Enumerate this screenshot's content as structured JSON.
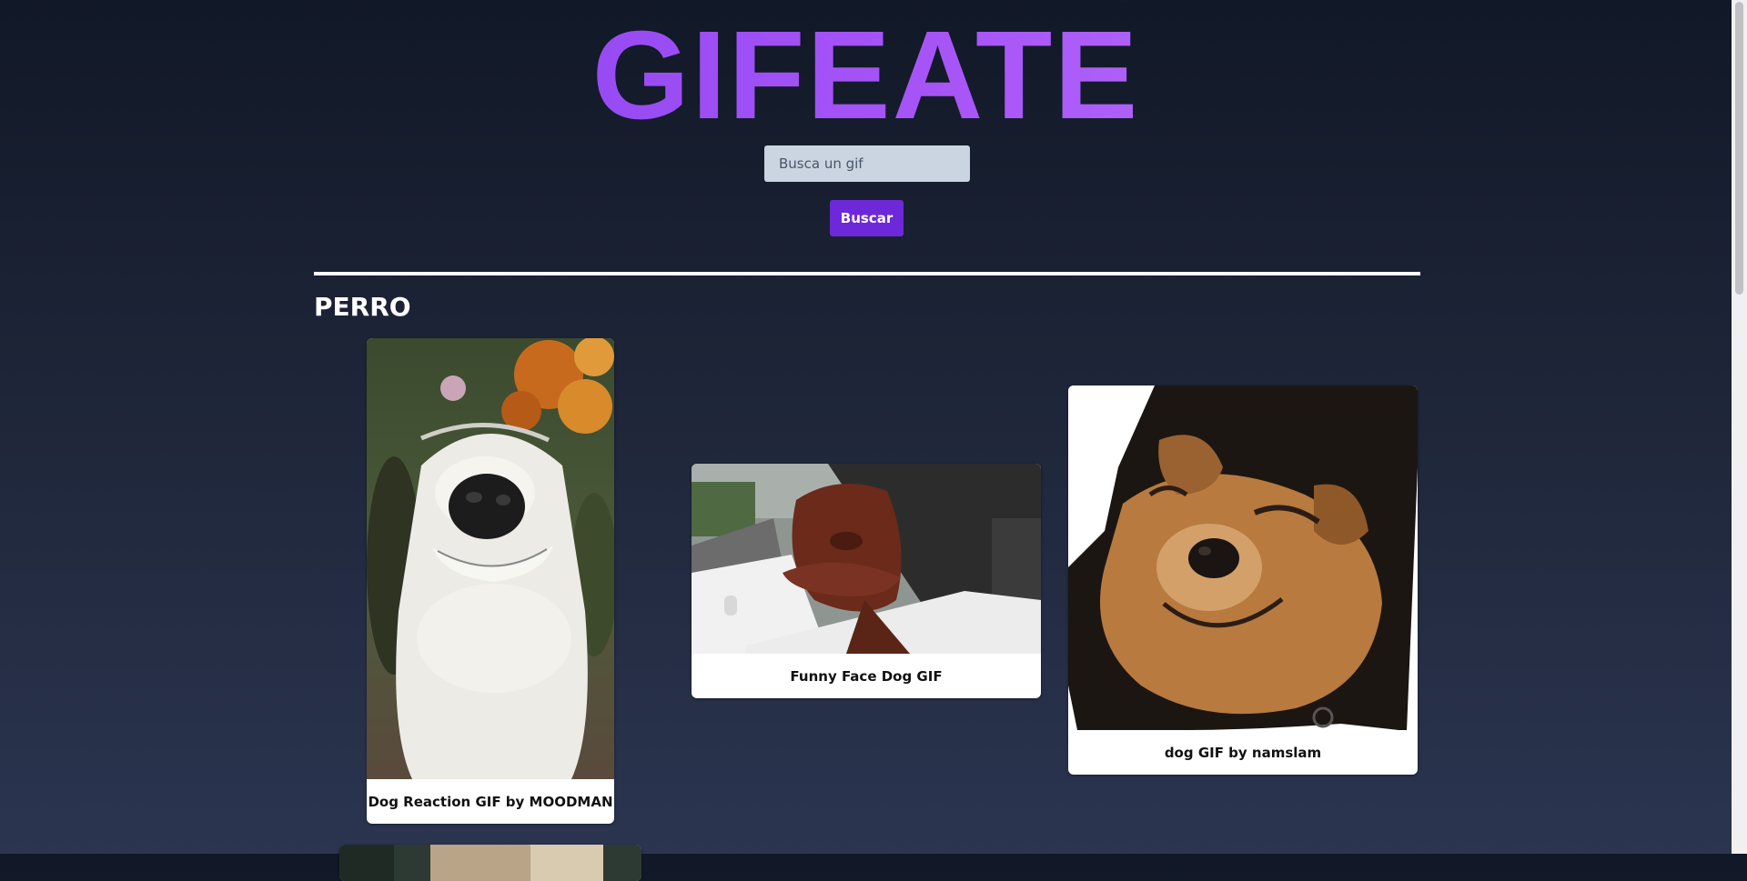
{
  "header": {
    "brand": "GIFEATE"
  },
  "search": {
    "placeholder": "Busca un gif",
    "value": "",
    "button_label": "Buscar"
  },
  "results": {
    "title": "PERRO",
    "gifs": [
      {
        "caption": "Dog Reaction GIF by MOODMAN"
      },
      {
        "caption": "Funny Face Dog GIF"
      },
      {
        "caption": "dog GIF by namslam"
      },
      {
        "caption": ""
      }
    ]
  },
  "colors": {
    "brand_gradient_start": "#7c3aed",
    "brand_gradient_end": "#c084fc",
    "button": "#6d28d9",
    "input_background": "#cbd5e1",
    "page_background_top": "#111827",
    "page_background_bottom": "#2b3550"
  }
}
